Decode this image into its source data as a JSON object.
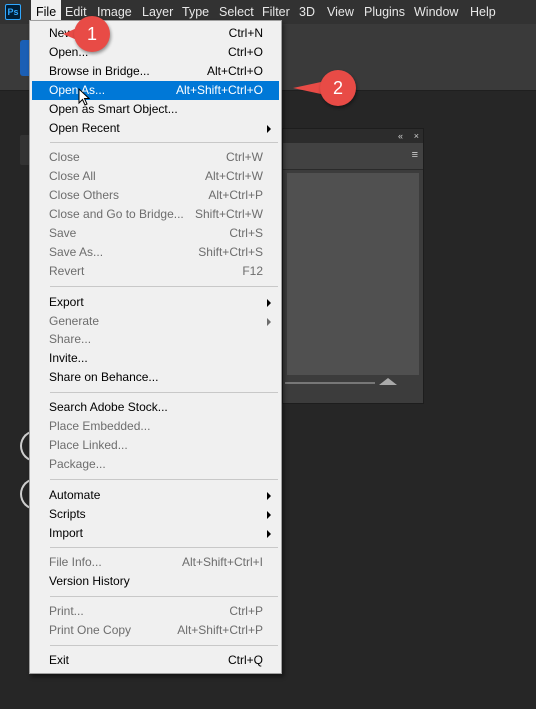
{
  "app": {
    "logo_text": "Ps",
    "accent_color": "#0078d7",
    "badge_color": "#e84b46"
  },
  "menubar": {
    "items": [
      "File",
      "Edit",
      "Image",
      "Layer",
      "Type",
      "Select",
      "Filter",
      "3D",
      "View",
      "Plugins",
      "Window",
      "Help"
    ]
  },
  "file_menu": {
    "items": [
      {
        "label": "New...",
        "shortcut": "Ctrl+N"
      },
      {
        "label": "Open...",
        "shortcut": "Ctrl+O"
      },
      {
        "label": "Browse in Bridge...",
        "shortcut": "Alt+Ctrl+O"
      },
      {
        "label": "Open As...",
        "shortcut": "Alt+Shift+Ctrl+O"
      },
      {
        "label": "Open as Smart Object...",
        "shortcut": ""
      },
      {
        "label": "Open Recent",
        "shortcut": ""
      },
      {
        "label": "Close",
        "shortcut": "Ctrl+W"
      },
      {
        "label": "Close All",
        "shortcut": "Alt+Ctrl+W"
      },
      {
        "label": "Close Others",
        "shortcut": "Alt+Ctrl+P"
      },
      {
        "label": "Close and Go to Bridge...",
        "shortcut": "Shift+Ctrl+W"
      },
      {
        "label": "Save",
        "shortcut": "Ctrl+S"
      },
      {
        "label": "Save As...",
        "shortcut": "Shift+Ctrl+S"
      },
      {
        "label": "Revert",
        "shortcut": "F12"
      },
      {
        "label": "Export",
        "shortcut": ""
      },
      {
        "label": "Generate",
        "shortcut": ""
      },
      {
        "label": "Share...",
        "shortcut": ""
      },
      {
        "label": "Invite...",
        "shortcut": ""
      },
      {
        "label": "Share on Behance...",
        "shortcut": ""
      },
      {
        "label": "Search Adobe Stock...",
        "shortcut": ""
      },
      {
        "label": "Place Embedded...",
        "shortcut": ""
      },
      {
        "label": "Place Linked...",
        "shortcut": ""
      },
      {
        "label": "Package...",
        "shortcut": ""
      },
      {
        "label": "Automate",
        "shortcut": ""
      },
      {
        "label": "Scripts",
        "shortcut": ""
      },
      {
        "label": "Import",
        "shortcut": ""
      },
      {
        "label": "File Info...",
        "shortcut": "Alt+Shift+Ctrl+I"
      },
      {
        "label": "Version History",
        "shortcut": ""
      },
      {
        "label": "Print...",
        "shortcut": "Ctrl+P"
      },
      {
        "label": "Print One Copy",
        "shortcut": "Alt+Shift+Ctrl+P"
      },
      {
        "label": "Exit",
        "shortcut": "Ctrl+Q"
      }
    ]
  },
  "annotations": {
    "step1": "1",
    "step2": "2"
  },
  "panel": {
    "collapse_glyph": "«",
    "close_glyph": "×",
    "menu_glyph": "≡"
  }
}
